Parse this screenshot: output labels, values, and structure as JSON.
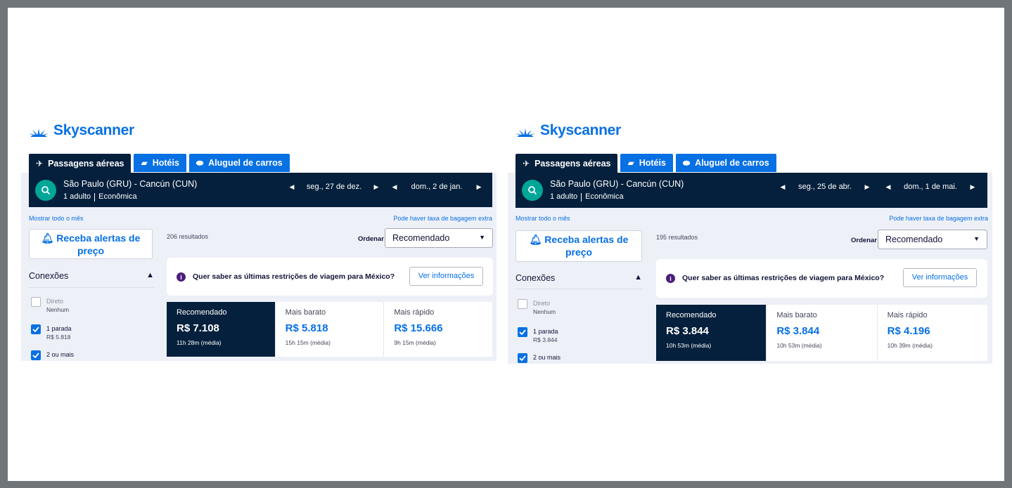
{
  "brand": {
    "name": "Skyscanner",
    "color": "#0770e3",
    "dark": "#05203c",
    "accent": "#00a698"
  },
  "panels": [
    {
      "tabs": [
        {
          "label": "Passagens aéreas",
          "icon": "plane-icon"
        },
        {
          "label": "Hotéis",
          "icon": "bed-icon"
        },
        {
          "label": "Aluguel de carros",
          "icon": "car-icon"
        }
      ],
      "search": {
        "route": "São Paulo (GRU) - Cancún (CUN)",
        "passengers": "1 adulto",
        "cabin": "Econômica",
        "depart": "seg., 27 de dez.",
        "return": "dom., 2 de jan."
      },
      "links": {
        "month": "Mostrar todo o mês",
        "baggage": "Pode haver taxa de bagagem extra"
      },
      "alert_button": "Receba alertas de preço",
      "filters": {
        "title": "Conexões",
        "items": [
          {
            "label": "Direto",
            "sub": "Nenhum",
            "checked": false
          },
          {
            "label": "1 parada",
            "sub": "R$ 5.818",
            "checked": true
          },
          {
            "label": "2 ou mais",
            "sub": "",
            "checked": true
          }
        ]
      },
      "results_count": "206 resultados",
      "sort": {
        "label": "Ordenar",
        "value": "Recomendado"
      },
      "info": {
        "text": "Quer saber as últimas restrições de viagem para México?",
        "button": "Ver informações"
      },
      "sort_cards": [
        {
          "label": "Recomendado",
          "price": "R$ 7.108",
          "duration": "11h 28m (média)"
        },
        {
          "label": "Mais barato",
          "price": "R$ 5.818",
          "duration": "15h 15m (média)"
        },
        {
          "label": "Mais rápido",
          "price": "R$ 15.666",
          "duration": "9h 15m (média)"
        }
      ]
    },
    {
      "tabs": [
        {
          "label": "Passagens aéreas",
          "icon": "plane-icon"
        },
        {
          "label": "Hotéis",
          "icon": "bed-icon"
        },
        {
          "label": "Aluguel de carros",
          "icon": "car-icon"
        }
      ],
      "search": {
        "route": "São Paulo (GRU) - Cancún (CUN)",
        "passengers": "1 adulto",
        "cabin": "Econômica",
        "depart": "seg., 25 de abr.",
        "return": "dom., 1 de mai."
      },
      "links": {
        "month": "Mostrar todo o mês",
        "baggage": "Pode haver taxa de bagagem extra"
      },
      "alert_button": "Receba alertas de preço",
      "filters": {
        "title": "Conexões",
        "items": [
          {
            "label": "Direto",
            "sub": "Nenhum",
            "checked": false
          },
          {
            "label": "1 parada",
            "sub": "R$ 3.844",
            "checked": true
          },
          {
            "label": "2 ou mais",
            "sub": "",
            "checked": true
          }
        ]
      },
      "results_count": "195 resultados",
      "sort": {
        "label": "Ordenar",
        "value": "Recomendado"
      },
      "info": {
        "text": "Quer saber as últimas restrições de viagem para México?",
        "button": "Ver informações"
      },
      "sort_cards": [
        {
          "label": "Recomendado",
          "price": "R$ 3.844",
          "duration": "10h 53m (média)"
        },
        {
          "label": "Mais barato",
          "price": "R$ 3.844",
          "duration": "10h 53m (média)"
        },
        {
          "label": "Mais rápido",
          "price": "R$ 4.196",
          "duration": "10h 39m (média)"
        }
      ]
    }
  ]
}
